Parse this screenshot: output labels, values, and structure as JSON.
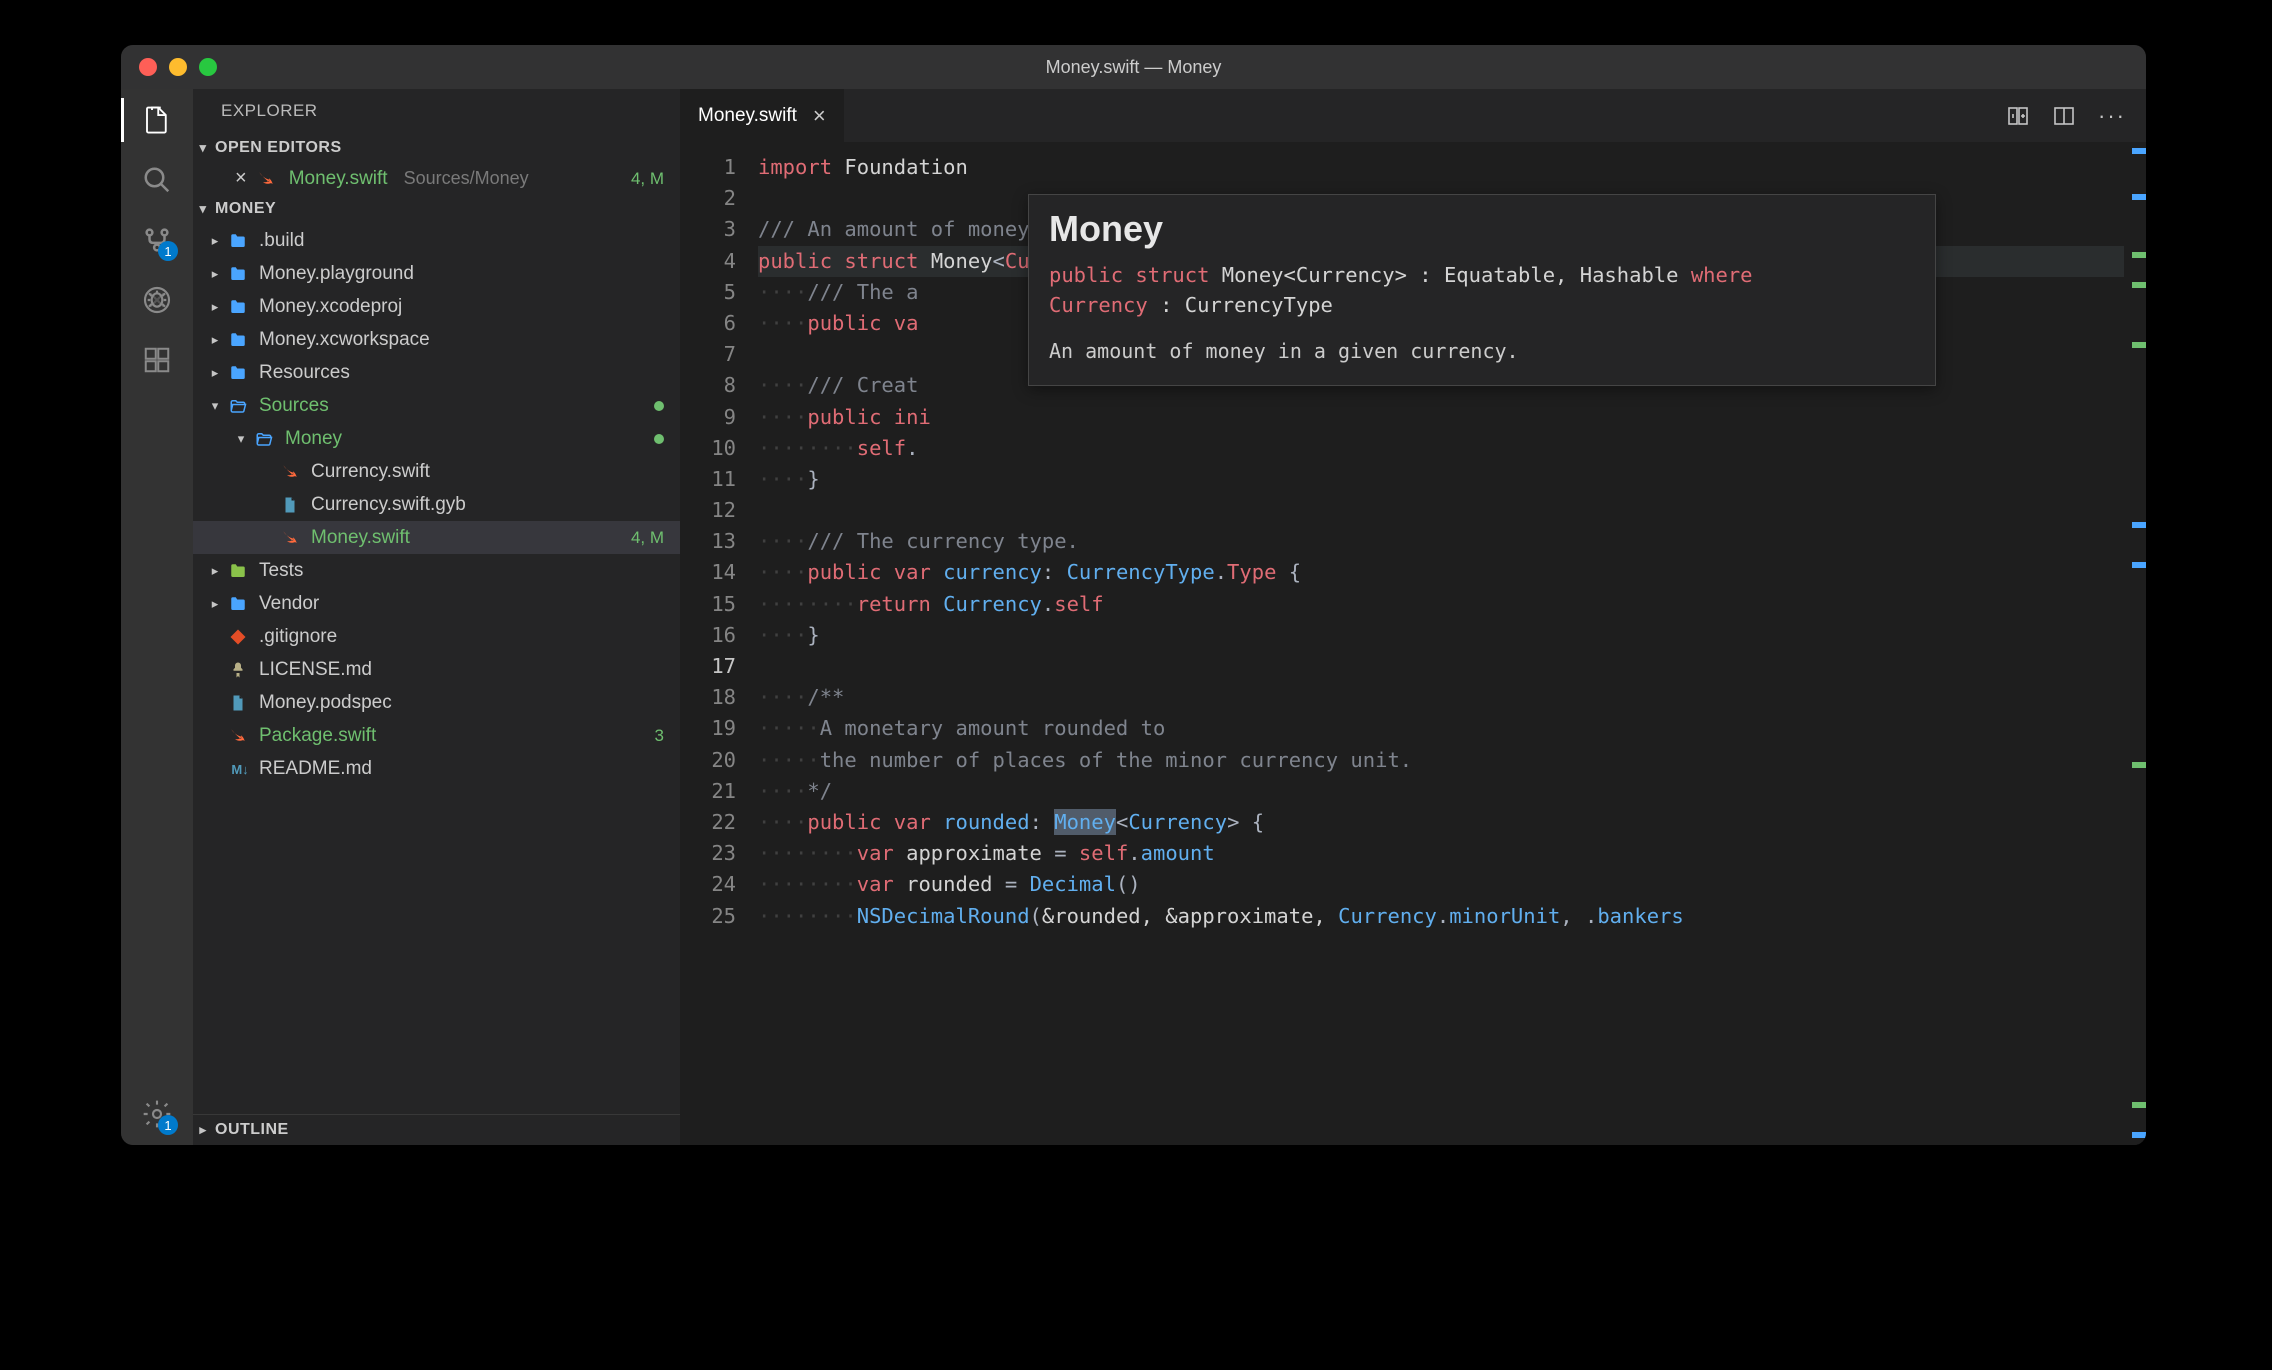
{
  "window": {
    "title": "Money.swift — Money"
  },
  "activity": {
    "badge_scm": "1",
    "badge_settings": "1"
  },
  "sidebar": {
    "title": "EXPLORER",
    "sections": {
      "open_editors": "OPEN EDITORS",
      "workspace": "MONEY",
      "outline": "OUTLINE"
    },
    "open_editor": {
      "file": "Money.swift",
      "path": "Sources/Money",
      "changes": "4, M"
    },
    "tree": [
      {
        "name": ".build",
        "type": "folder"
      },
      {
        "name": "Money.playground",
        "type": "folder"
      },
      {
        "name": "Money.xcodeproj",
        "type": "folder"
      },
      {
        "name": "Money.xcworkspace",
        "type": "folder"
      },
      {
        "name": "Resources",
        "type": "folder"
      },
      {
        "name": "Sources",
        "type": "folder-open",
        "color": "g",
        "dot": true,
        "children": [
          {
            "name": "Money",
            "type": "folder-open",
            "color": "g",
            "dot": true,
            "children": [
              {
                "name": "Currency.swift",
                "type": "swift"
              },
              {
                "name": "Currency.swift.gyb",
                "type": "file"
              },
              {
                "name": "Money.swift",
                "type": "swift",
                "color": "g",
                "meta": "4, M",
                "selected": true
              }
            ]
          }
        ]
      },
      {
        "name": "Tests",
        "type": "folder-lib"
      },
      {
        "name": "Vendor",
        "type": "folder"
      },
      {
        "name": ".gitignore",
        "type": "git"
      },
      {
        "name": "LICENSE.md",
        "type": "license"
      },
      {
        "name": "Money.podspec",
        "type": "file"
      },
      {
        "name": "Package.swift",
        "type": "swift",
        "color": "g",
        "meta": "3"
      },
      {
        "name": "README.md",
        "type": "md"
      }
    ]
  },
  "tab": {
    "label": "Money.swift"
  },
  "code": {
    "lines": [
      {
        "n": 1,
        "html": "<span class='k'>import</span> <span class='w'>Foundation</span>"
      },
      {
        "n": 2,
        "html": ""
      },
      {
        "n": 3,
        "html": "<span class='c'>/// An amount of money in a given currency.</span>"
      },
      {
        "n": 4,
        "html": "<span class='k'>public</span> <span class='k'>struct</span> <span class='w'>Money</span><span class='p'>&lt;</span><span class='k'>Currency</span><span class='p'>: </span><span class='t'>CurrencyType</span><span class='p'>&gt;: </span><span class='t'>Equatable</span><span class='p'>, </span><span class='t'>Hashable</span><span class='p'> {</span>",
        "hl": true
      },
      {
        "n": 5,
        "html": "<span class='dots'>····</span><span class='c'>/// The a</span>"
      },
      {
        "n": 6,
        "html": "<span class='dots'>····</span><span class='k'>public</span> <span class='k'>va</span>"
      },
      {
        "n": 7,
        "html": ""
      },
      {
        "n": 8,
        "html": "<span class='dots'>····</span><span class='c'>/// Creat</span>"
      },
      {
        "n": 9,
        "html": "<span class='dots'>····</span><span class='k'>public</span> <span class='k'>ini</span>"
      },
      {
        "n": 10,
        "html": "<span class='dots'>········</span><span class='k'>self</span><span class='p'>.</span>"
      },
      {
        "n": 11,
        "html": "<span class='dots'>····</span><span class='p'>}</span>"
      },
      {
        "n": 12,
        "html": ""
      },
      {
        "n": 13,
        "html": "<span class='dots'>····</span><span class='c'>/// The currency type.</span>"
      },
      {
        "n": 14,
        "html": "<span class='dots'>····</span><span class='k'>public</span> <span class='k'>var</span> <span class='t'>currency</span><span class='p'>: </span><span class='t'>CurrencyType</span><span class='p'>.</span><span class='k'>Type</span> <span class='p'>{</span>"
      },
      {
        "n": 15,
        "html": "<span class='dots'>········</span><span class='k'>return</span> <span class='t'>Currency</span><span class='p'>.</span><span class='k'>self</span>"
      },
      {
        "n": 16,
        "html": "<span class='dots'>····</span><span class='p'>}</span>"
      },
      {
        "n": 17,
        "html": "",
        "cur": true
      },
      {
        "n": 18,
        "html": "<span class='dots'>····</span><span class='c'>/**</span>"
      },
      {
        "n": 19,
        "html": "<span class='dots'>·····</span><span class='c'>A monetary amount rounded to</span>"
      },
      {
        "n": 20,
        "html": "<span class='dots'>·····</span><span class='c'>the number of places of the minor currency unit.</span>"
      },
      {
        "n": 21,
        "html": "<span class='dots'>····</span><span class='c'>*/</span>"
      },
      {
        "n": 22,
        "html": "<span class='dots'>····</span><span class='k'>public</span> <span class='k'>var</span> <span class='t'>rounded</span><span class='p'>: </span><span class='t' style='background:#515c6a;padding:1px 0'>Money</span><span class='p'>&lt;</span><span class='t'>Currency</span><span class='p'>&gt; {</span>"
      },
      {
        "n": 23,
        "html": "<span class='dots'>········</span><span class='k'>var</span> <span class='w'>approximate</span> <span class='p'>=</span> <span class='k'>self</span><span class='p'>.</span><span class='t'>amount</span>"
      },
      {
        "n": 24,
        "html": "<span class='dots'>········</span><span class='k'>var</span> <span class='w'>rounded</span> <span class='p'>=</span> <span class='t'>Decimal</span><span class='p'>()</span>"
      },
      {
        "n": 25,
        "html": "<span class='dots'>········</span><span class='t'>NSDecimalRound</span><span class='p'>(</span><span class='w'>&amp;rounded, &amp;approximate, </span><span class='t'>Currency</span><span class='p'>.</span><span class='t'>minorUnit</span><span class='p'>, .</span><span class='t'>bankers</span>"
      }
    ]
  },
  "hover": {
    "heading": "Money",
    "sig1_pre": "public ",
    "sig1_kw": "struct",
    "sig1_mid": " Money<Currency> : Equatable, Hashable ",
    "sig1_where": "where",
    "sig2_kw": "Currency",
    "sig2_rest": " : CurrencyType",
    "doc": "An amount of money in a given currency."
  },
  "icons": {
    "swift": "#ff6a3d",
    "folder": "#4aa5ff",
    "folder_open": "#4aa5ff",
    "file": "#519aba",
    "git": "#e44d26",
    "license": "#b8b087",
    "md": "#519aba"
  }
}
